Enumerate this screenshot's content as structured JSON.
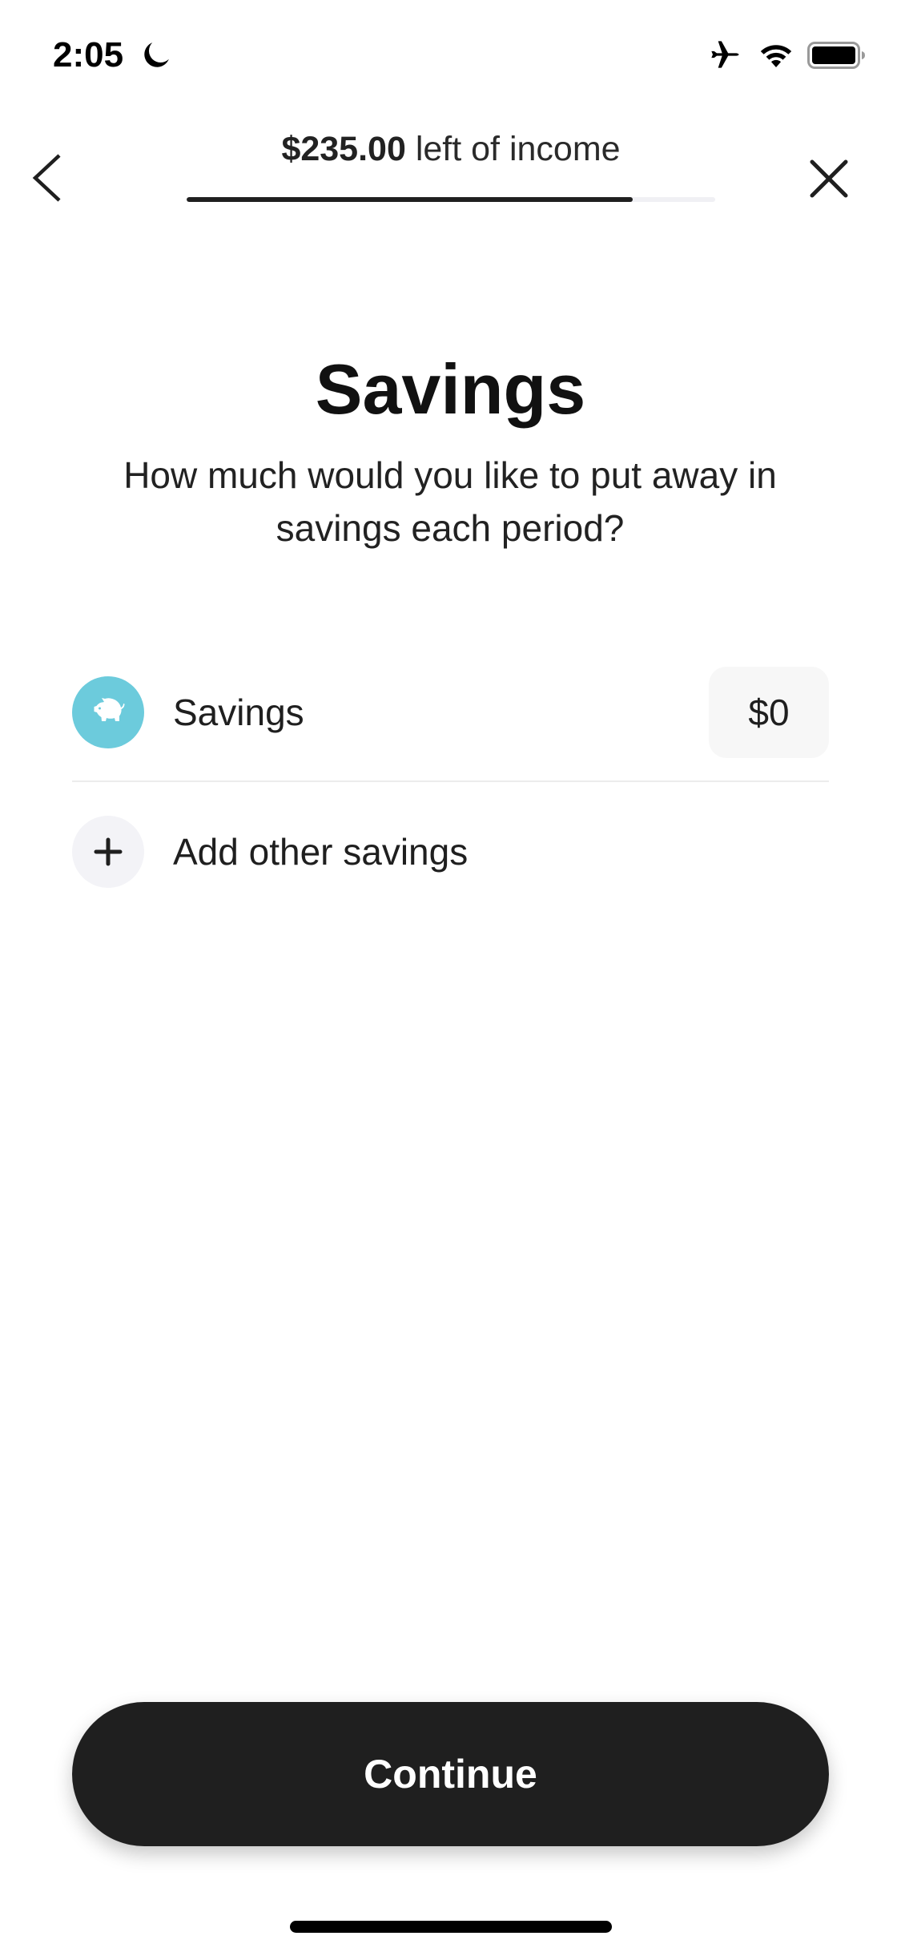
{
  "status_bar": {
    "time": "2:05",
    "icons": [
      "moon-icon",
      "airplane-mode-icon",
      "wifi-icon",
      "battery-icon"
    ]
  },
  "header": {
    "income_amount": "$235.00",
    "income_suffix": " left of income",
    "progress_fraction": 0.844,
    "back_icon": "chevron-left-icon",
    "close_icon": "close-icon"
  },
  "main": {
    "title": "Savings",
    "subtitle": "How much would you like to put away in savings each period?",
    "items": [
      {
        "icon": "piggy-bank-icon",
        "label": "Savings",
        "amount": "$0",
        "icon_color": "#6ccbdc"
      }
    ],
    "add_item": {
      "icon": "plus-icon",
      "label": "Add other savings"
    }
  },
  "footer": {
    "continue_label": "Continue"
  },
  "colors": {
    "accent_dark": "#1f1f1f",
    "savings_icon_bg": "#6ccbdc",
    "progress_track": "#f0f0f4",
    "amount_box_bg": "#f7f7f7",
    "add_icon_bg": "#f3f3f7"
  }
}
